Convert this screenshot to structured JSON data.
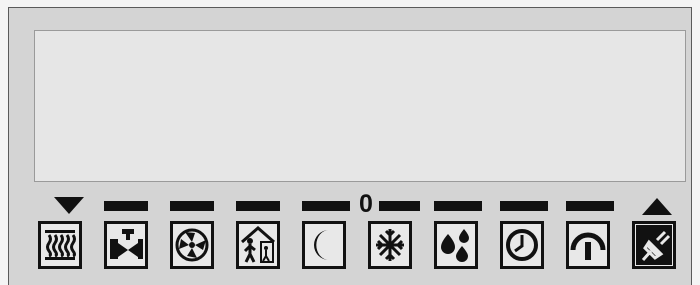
{
  "display": {
    "center_value": "0",
    "status_icons": [
      {
        "icon": "heating-coil-icon"
      },
      {
        "icon": "valve-icon"
      },
      {
        "icon": "fan-icon"
      },
      {
        "icon": "occupancy-icon"
      },
      {
        "icon": "night-mode-icon"
      },
      {
        "icon": "snowflake-icon"
      },
      {
        "icon": "humidity-icon"
      },
      {
        "icon": "clock-icon"
      },
      {
        "icon": "gauge-icon"
      },
      {
        "icon": "plug-icon"
      }
    ],
    "colors": {
      "panel": "#d4d4d4",
      "screen": "#e6e6e6",
      "segment": "#111111"
    }
  }
}
